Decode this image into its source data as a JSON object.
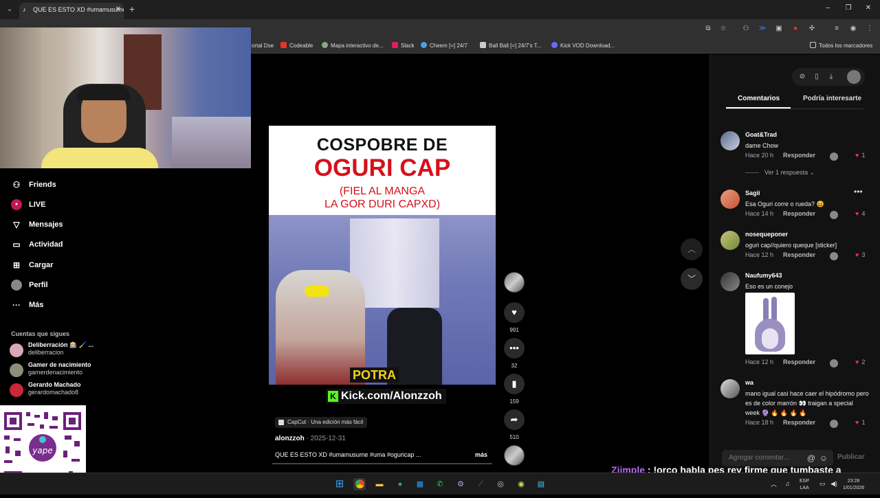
{
  "browser": {
    "tab_title": "QUE ES ESTO XD #umamusume",
    "bookmarks": [
      "ortal Dse",
      "Codeable",
      "Mapa interactivo de...",
      "Slack",
      "Cheem [=] 24/7",
      "Ball Ball [=] 24/7's T...",
      "Kick VOD Download..."
    ],
    "all_bookmarks": "Todos los marcadores"
  },
  "nav": {
    "items": [
      {
        "label": "Friends",
        "icon": "friends-icon"
      },
      {
        "label": "LIVE",
        "icon": "live-icon"
      },
      {
        "label": "Mensajes",
        "icon": "messages-icon"
      },
      {
        "label": "Actividad",
        "icon": "activity-icon"
      },
      {
        "label": "Cargar",
        "icon": "upload-icon"
      },
      {
        "label": "Perfil",
        "icon": "profile-avatar"
      },
      {
        "label": "Más",
        "icon": "more-icon"
      }
    ],
    "following_title": "Cuentas que sigues",
    "following": [
      {
        "name": "Deliberración 🎰 🖌️ ...",
        "handle": "deliberracion"
      },
      {
        "name": "Gamer de nacimiento",
        "handle": "gamerdenacimiento"
      },
      {
        "name": "Gerardo Machado",
        "handle": "gerardomachado8"
      }
    ]
  },
  "video": {
    "title_line1": "COSPOBRE DE",
    "title_line2": "OGURI CAP",
    "title_line3": "(FIEL AL MANGA",
    "title_line4": "LA GOR DURI CAPXD)",
    "caption": "POTRA",
    "kick_link": "Kick.com/Alonzzoh",
    "capcut_label": "CapCut · Una edición más fácil",
    "author": "alonzzoh",
    "date": " · 2025-12-31",
    "description": "QUE ES ESTO XD #umamusume #uma #oguricap ...",
    "more_label": "más"
  },
  "actions": {
    "likes": "991",
    "comments": "32",
    "saves": "159",
    "shares": "510"
  },
  "comments_panel": {
    "tab_comments": "Comentarios",
    "tab_suggested": "Podría interesarte",
    "reply_label": "Responder",
    "view_replies": "Ver 1 respuesta",
    "input_placeholder": "Agregar comentar...",
    "publish_label": "Publicar",
    "items": [
      {
        "user": "Goat&Trad",
        "text": "dame Chow",
        "time": "Hace 20 h",
        "likes": "1"
      },
      {
        "user": "Sagii",
        "text": "Esa Oguri corre o rueda? 😆",
        "time": "Hace 14 h",
        "likes": "4"
      },
      {
        "user": "nosequeponer",
        "text": "oguri cap//quiero queque [sticker]",
        "time": "Hace 12 h",
        "likes": "3"
      },
      {
        "user": "Naufumy643",
        "text": "Eso es un conejo",
        "time": "Hace 12 h",
        "likes": "2"
      },
      {
        "user": "wa",
        "text": "mano igual casi hace caer el hipódromo pero es de color marrón 👀 traigan a special week 🔮 🔥 🔥 🔥 🔥",
        "time": "Hace 18 h",
        "likes": "1"
      }
    ]
  },
  "chat": {
    "name": "Ziimple",
    "message": " : !orco habla pes rey firme que tumbaste a nobita"
  },
  "taskbar": {
    "lang": "ESP",
    "lang2": "LAA",
    "time": "23:28",
    "date": "1/01/2026"
  },
  "colors": {
    "accent": "#fe2c55",
    "kick_green": "#53fc18",
    "chat_name": "#b56cf5"
  }
}
